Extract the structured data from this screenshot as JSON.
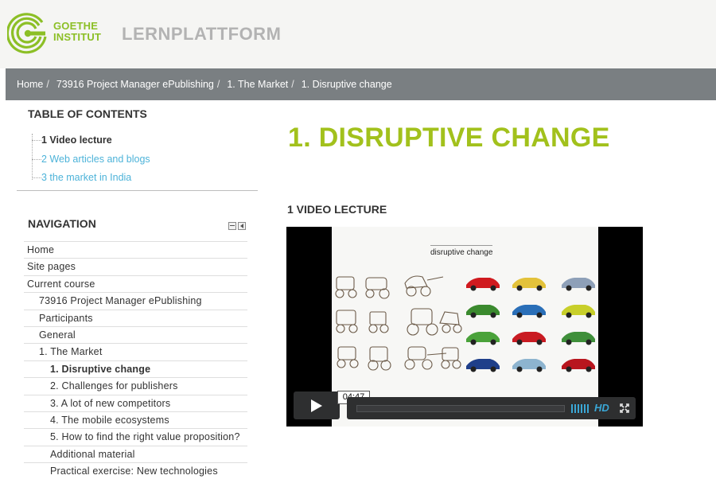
{
  "header": {
    "logo_line1": "GOETHE",
    "logo_line2": "INSTITUT",
    "platform_title": "LERNPLATTFORM"
  },
  "breadcrumb": {
    "items": [
      "Home",
      "73916 Project Manager ePublishing",
      "1. The Market",
      "1. Disruptive change"
    ],
    "separator": "/"
  },
  "toc": {
    "title": "TABLE OF CONTENTS",
    "items": [
      {
        "label": "1 Video lecture",
        "active": true
      },
      {
        "label": "2 Web articles and blogs",
        "active": false
      },
      {
        "label": "3 the market in India",
        "active": false
      }
    ]
  },
  "navigation": {
    "title": "NAVIGATION",
    "items": [
      {
        "label": "Home"
      },
      {
        "label": "Site pages"
      },
      {
        "label": "Current course"
      },
      {
        "label": "73916 Project Manager ePublishing"
      },
      {
        "label": "Participants"
      },
      {
        "label": "General"
      },
      {
        "label": "1. The Market"
      },
      {
        "label": "1. Disruptive change"
      },
      {
        "label": "2. Challenges for publishers"
      },
      {
        "label": "3. A lot of new competitors"
      },
      {
        "label": "4. The mobile ecosystems"
      },
      {
        "label": "5. How to find the right value proposition?"
      },
      {
        "label": "Additional material"
      },
      {
        "label": "Practical exercise: New technologies"
      }
    ]
  },
  "main": {
    "page_title": "1. DISRUPTIVE CHANGE",
    "section_title": "1 VIDEO LECTURE",
    "video": {
      "slide_caption": "disruptive change",
      "time": "04:47",
      "hd_label": "HD"
    }
  },
  "colors": {
    "brand_green": "#a2c11c",
    "link_blue": "#4db3d9",
    "crumb_bar": "#7a7f82",
    "player_accent": "#3aa7d6"
  }
}
